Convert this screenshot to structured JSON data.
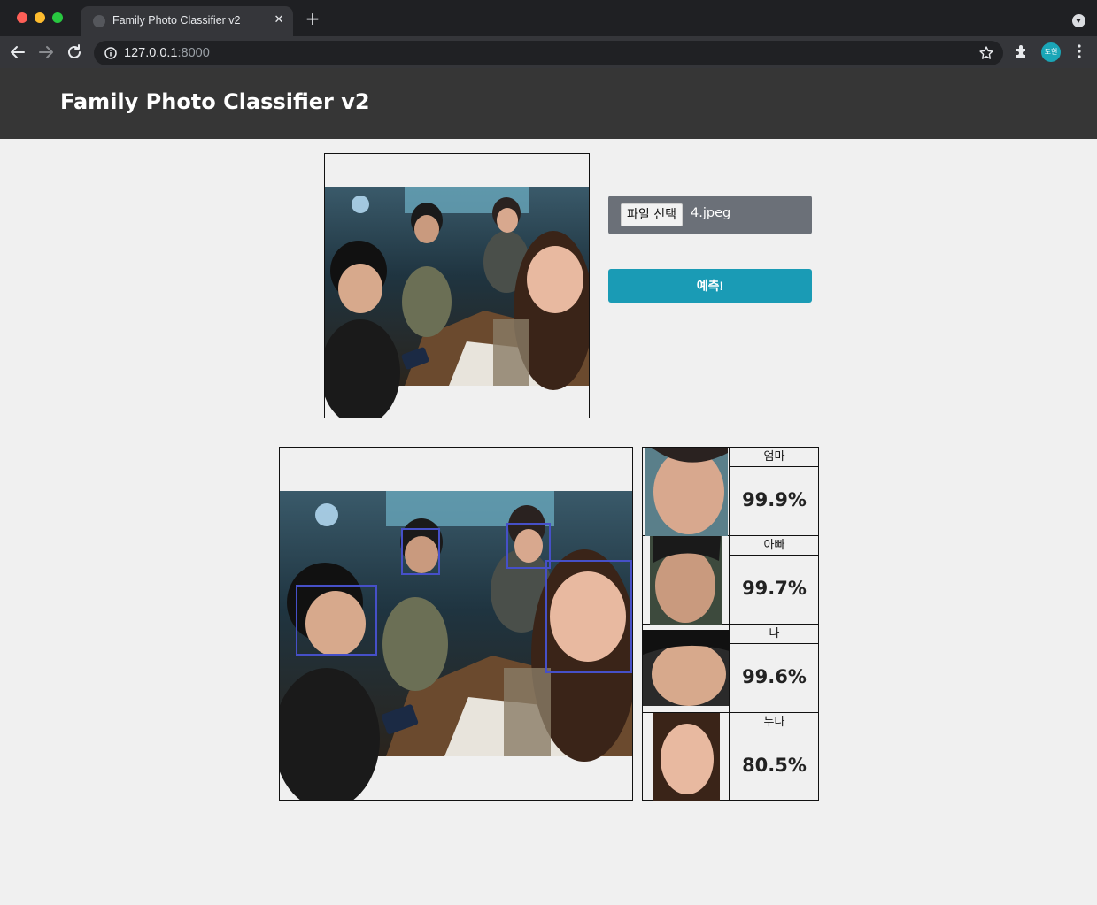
{
  "browser": {
    "tab_title": "Family Photo Classifier v2",
    "tab_close": "✕",
    "new_tab": "+",
    "url_host": "127.0.0.1",
    "url_port": ":8000",
    "profile_initials": "도현"
  },
  "header": {
    "title": "Family Photo Classifier v2"
  },
  "upload": {
    "choose_file_label": "파일 선택",
    "file_name": "4.jpeg",
    "predict_label": "예측!"
  },
  "results": {
    "faces": [
      {
        "name": "엄마",
        "probability": "99.9%"
      },
      {
        "name": "아빠",
        "probability": "99.7%"
      },
      {
        "name": "나",
        "probability": "99.6%"
      },
      {
        "name": "누나",
        "probability": "80.5%"
      }
    ]
  },
  "colors": {
    "header_bg": "#363636",
    "predict_button": "#1a9bb5",
    "file_picker_bg": "#6b7078",
    "bbox_stroke": "#4650c8"
  }
}
